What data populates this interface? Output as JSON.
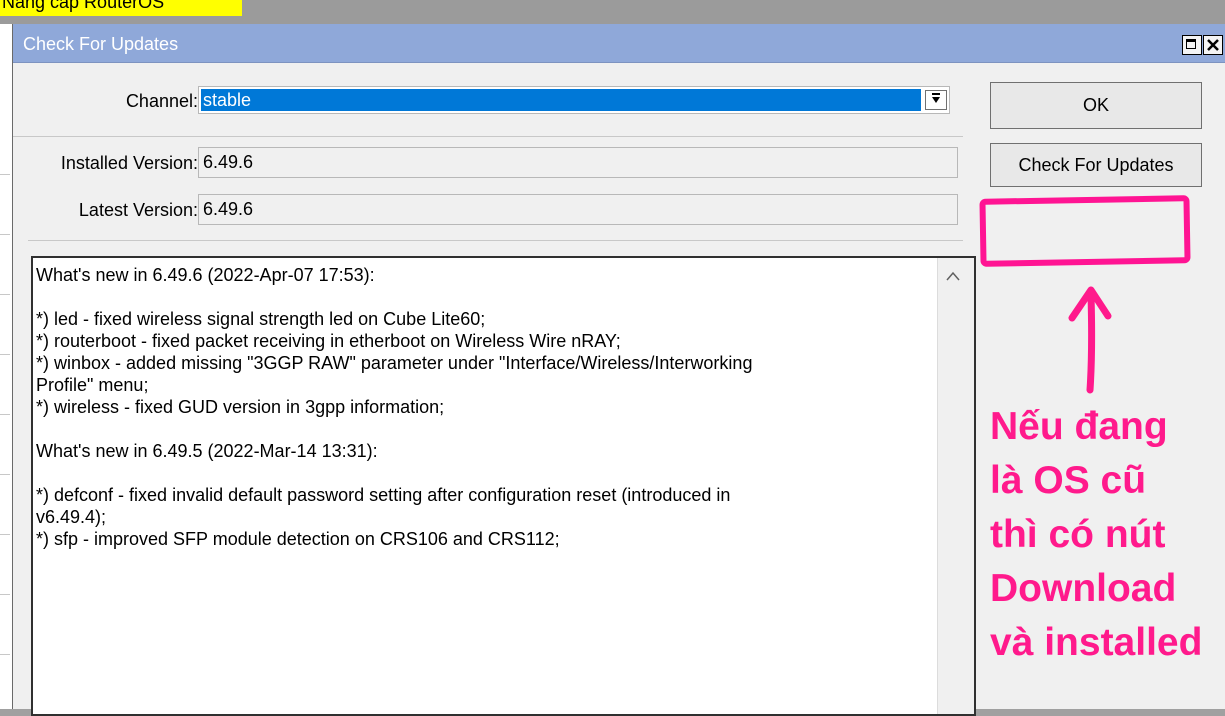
{
  "top_highlight": "Nâng cấp RouterOS",
  "window": {
    "title": "Check For Updates"
  },
  "channel": {
    "label": "Channel:",
    "value": "stable"
  },
  "installed": {
    "label": "Installed Version:",
    "value": "6.49.6"
  },
  "latest": {
    "label": "Latest Version:",
    "value": "6.49.6"
  },
  "buttons": {
    "ok": "OK",
    "check": "Check For Updates"
  },
  "notes": [
    "What's new in 6.49.6 (2022-Apr-07 17:53):",
    "",
    "*) led - fixed wireless signal strength led on Cube Lite60;",
    "*) routerboot - fixed packet receiving in etherboot on Wireless Wire nRAY;",
    "*) winbox - added missing \"3GGP RAW\" parameter under \"Interface/Wireless/Interworking",
    "Profile\" menu;",
    "*) wireless - fixed GUD version in 3gpp information;",
    "",
    "What's new in 6.49.5 (2022-Mar-14 13:31):",
    "",
    "*) defconf - fixed invalid default password setting after configuration reset (introduced in",
    "v6.49.4);",
    "*) sfp - improved SFP module detection on CRS106 and CRS112;"
  ],
  "annotation": {
    "lines": [
      "Nếu đang",
      "là OS cũ",
      "thì có nút",
      "Download",
      "và installed"
    ],
    "color": "#ff1a8c"
  },
  "colors": {
    "titlebar": "#8fa8d9",
    "selection": "#0078d7"
  }
}
